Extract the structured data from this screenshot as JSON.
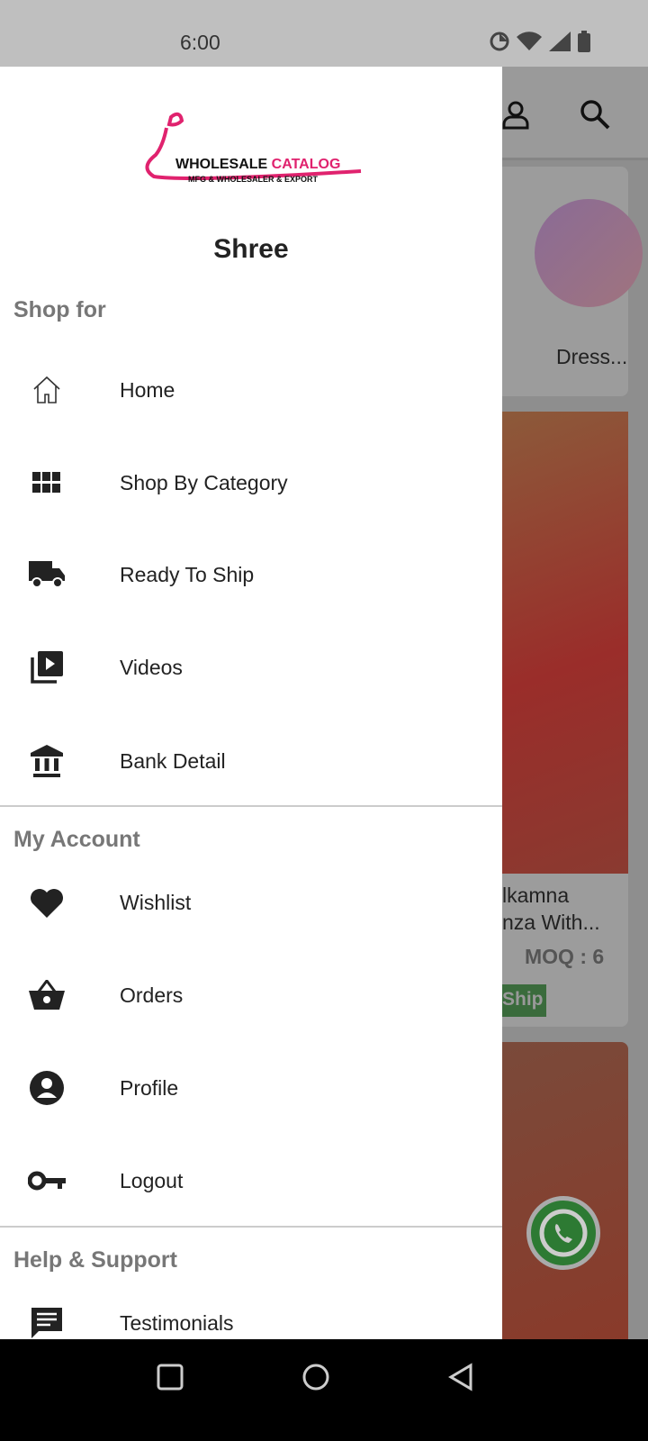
{
  "status_bar": {
    "time": "6:00"
  },
  "drawer": {
    "logo_text": "WHOLESALE CATALOG",
    "logo_tagline": "MFG & WHOLESALER & EXPORT",
    "user_name": "Shree",
    "sections": [
      {
        "title": "Shop for",
        "items": [
          {
            "label": "Home",
            "icon": "home-icon"
          },
          {
            "label": "Shop By Category",
            "icon": "grid-icon"
          },
          {
            "label": "Ready To Ship",
            "icon": "truck-icon"
          },
          {
            "label": "Videos",
            "icon": "video-library-icon"
          },
          {
            "label": "Bank Detail",
            "icon": "bank-icon"
          }
        ]
      },
      {
        "title": "My Account",
        "items": [
          {
            "label": "Wishlist",
            "icon": "heart-icon"
          },
          {
            "label": "Orders",
            "icon": "basket-icon"
          },
          {
            "label": "Profile",
            "icon": "account-circle-icon"
          },
          {
            "label": "Logout",
            "icon": "key-icon"
          }
        ]
      },
      {
        "title": "Help & Support",
        "items": [
          {
            "label": "Testimonials",
            "icon": "comment-icon"
          }
        ]
      }
    ]
  },
  "background": {
    "category_label": "Dress...",
    "product_title_line1": "lkamna",
    "product_title_line2": "nza With...",
    "moq": "MOQ : 6",
    "badge": "Ship"
  },
  "colors": {
    "brand": "#e0226e",
    "badge": "#3d8a3f"
  }
}
